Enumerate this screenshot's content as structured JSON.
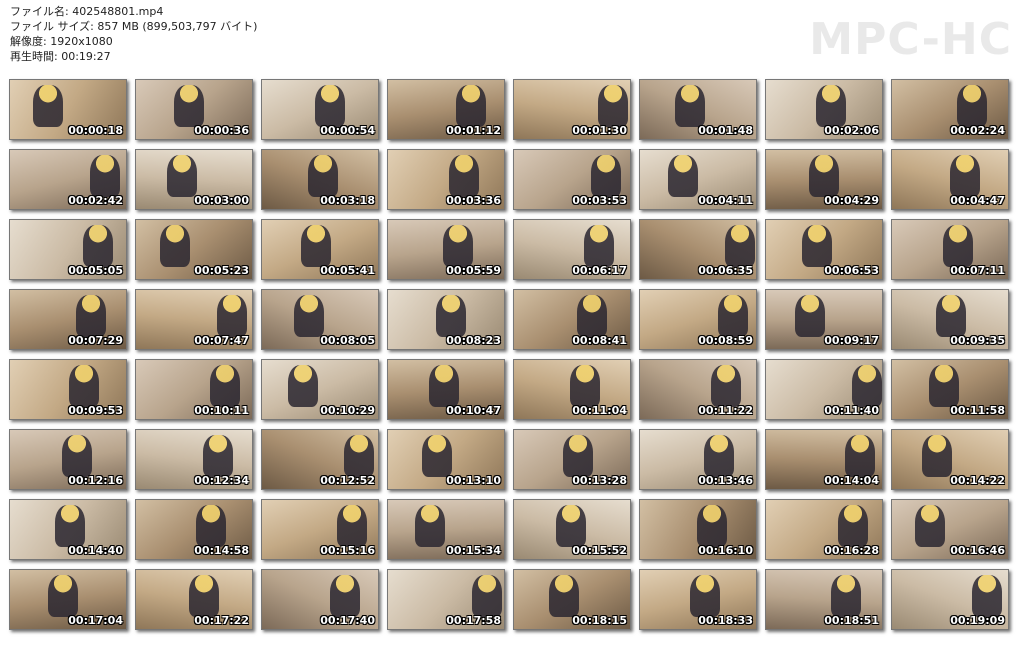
{
  "file_info": {
    "filename": "ファイル名: 402548801.mp4",
    "filesize": "ファイル サイズ: 857 MB (899,503,797 バイト)",
    "resolution": "解像度: 1920x1080",
    "duration": "再生時間: 00:19:27"
  },
  "logo": "MPC-HC",
  "thumbnails": [
    "00:00:18",
    "00:00:36",
    "00:00:54",
    "00:01:12",
    "00:01:30",
    "00:01:48",
    "00:02:06",
    "00:02:24",
    "00:02:42",
    "00:03:00",
    "00:03:18",
    "00:03:36",
    "00:03:53",
    "00:04:11",
    "00:04:29",
    "00:04:47",
    "00:05:05",
    "00:05:23",
    "00:05:41",
    "00:05:59",
    "00:06:17",
    "00:06:35",
    "00:06:53",
    "00:07:11",
    "00:07:29",
    "00:07:47",
    "00:08:05",
    "00:08:23",
    "00:08:41",
    "00:08:59",
    "00:09:17",
    "00:09:35",
    "00:09:53",
    "00:10:11",
    "00:10:29",
    "00:10:47",
    "00:11:04",
    "00:11:22",
    "00:11:40",
    "00:11:58",
    "00:12:16",
    "00:12:34",
    "00:12:52",
    "00:13:10",
    "00:13:28",
    "00:13:46",
    "00:14:04",
    "00:14:22",
    "00:14:40",
    "00:14:58",
    "00:15:16",
    "00:15:34",
    "00:15:52",
    "00:16:10",
    "00:16:28",
    "00:16:46",
    "00:17:04",
    "00:17:22",
    "00:17:40",
    "00:17:58",
    "00:18:15",
    "00:18:33",
    "00:18:51",
    "00:19:09"
  ]
}
